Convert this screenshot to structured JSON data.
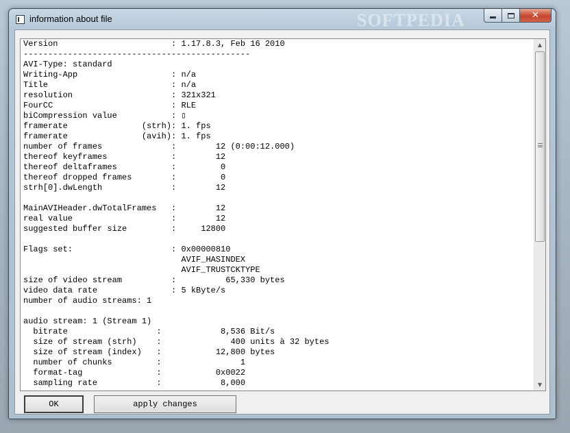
{
  "window": {
    "title": "information about file",
    "watermark": "SOFTPEDIA",
    "close_glyph": "✕"
  },
  "info_lines": [
    "Version                       : 1.17.8.3, Feb 16 2010",
    "----------------------------------------------",
    "AVI-Type: standard",
    "Writing-App                   : n/a",
    "Title                         : n/a",
    "resolution                    : 321x321",
    "FourCC                        : RLE",
    "biCompression value           : ▯",
    "framerate               (strh): 1. fps",
    "framerate               (avih): 1. fps",
    "number of frames              :        12 (0:00:12.000)",
    "thereof keyframes             :        12",
    "thereof deltaframes           :         0",
    "thereof dropped frames        :         0",
    "strh[0].dwLength              :        12",
    "",
    "MainAVIHeader.dwTotalFrames   :        12",
    "real value                    :        12",
    "suggested buffer size         :     12800",
    "",
    "Flags set:                    : 0x00000810",
    "                                AVIF_HASINDEX",
    "                                AVIF_TRUSTCKTYPE",
    "size of video stream          :          65,330 bytes",
    "video data rate               : 5 kByte/s",
    "number of audio streams: 1",
    "",
    "audio stream: 1 (Stream 1)",
    "  bitrate                  :            8,536 Bit/s",
    "  size of stream (strh)    :              400 units à 32 bytes",
    "  size of stream (index)   :           12,800 bytes",
    "  number of chunks         :                1",
    "  format-tag               :           0x0022",
    "  sampling rate            :            8,000"
  ],
  "buttons": {
    "ok": "OK",
    "apply": "apply changes"
  },
  "icons": {
    "scroll_up": "▲",
    "scroll_down": "▼"
  }
}
